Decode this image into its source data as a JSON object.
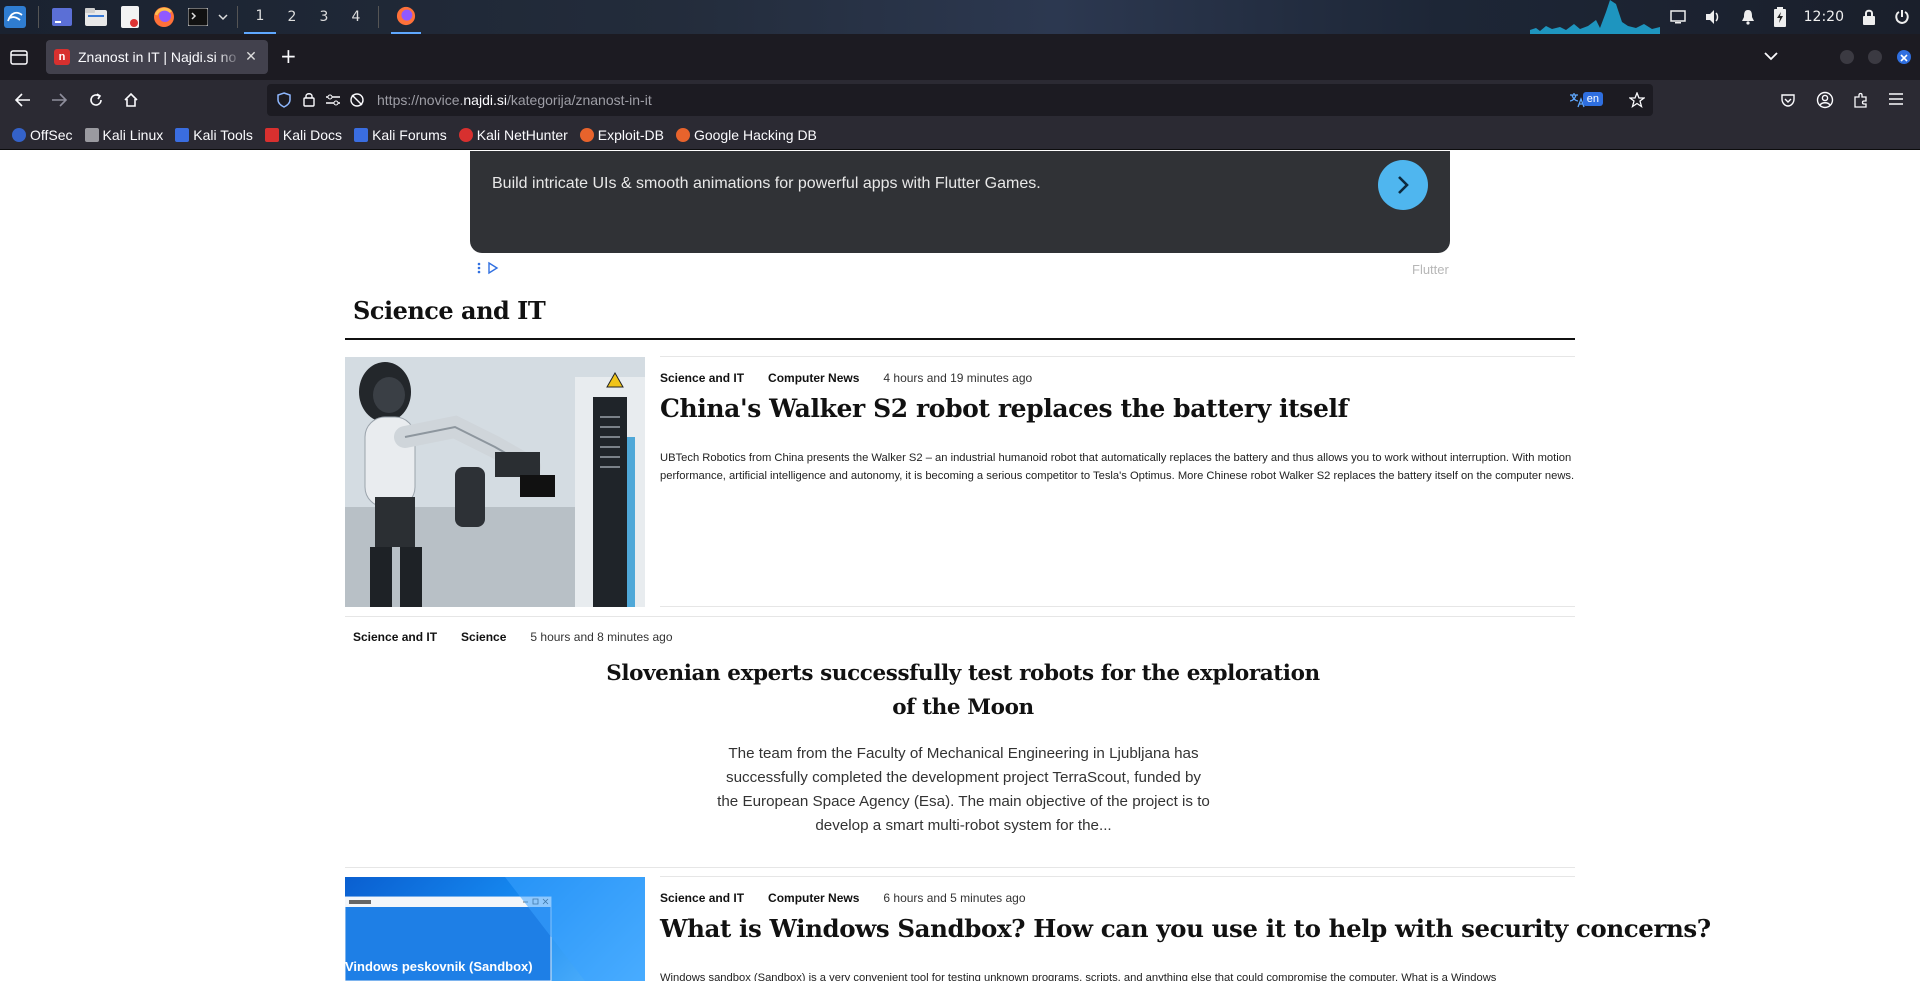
{
  "os_panel": {
    "workspaces": [
      "1",
      "2",
      "3",
      "4"
    ],
    "clock": "12:20",
    "icons": [
      "kali-menu-icon",
      "terminal-desktop-icon",
      "file-manager-icon",
      "text-editor-icon",
      "firefox-icon",
      "terminal-icon",
      "chevron-down-icon"
    ],
    "tray_icons": [
      "screen-icon",
      "volume-icon",
      "notification-bell-icon",
      "battery-icon",
      "lock-icon",
      "power-icon"
    ]
  },
  "browser": {
    "tab_title": "Znanost in IT | Najdi.si no",
    "tab_favicon_letter": "n",
    "url_prefix": "https://novice.",
    "url_host": "najdi.si",
    "url_path": "/kategorija/znanost-in-it",
    "translate_lang": "en",
    "bookmarks": [
      "OffSec",
      "Kali Linux",
      "Kali Tools",
      "Kali Docs",
      "Kali Forums",
      "Kali NetHunter",
      "Exploit-DB",
      "Google Hacking DB"
    ]
  },
  "ad": {
    "text": "Build intricate UIs & smooth animations for powerful apps with Flutter Games.",
    "brand": "Flutter"
  },
  "section": {
    "title": "Science and IT"
  },
  "articles": [
    {
      "category": "Science and IT",
      "subcategory": "Computer News",
      "time": "4 hours and 19 minutes ago",
      "headline": "China's Walker S2 robot replaces the battery itself",
      "summary": "UBTech Robotics from China presents the Walker S2 – an industrial humanoid robot that automatically replaces the battery and thus allows you to work without interruption. With motion performance, artificial intelligence and autonomy, it is becoming a serious competitor to Tesla's Optimus. More Chinese robot Walker S2 replaces the battery itself on the computer news."
    },
    {
      "category": "Science and IT",
      "subcategory": "Science",
      "time": "5 hours and 8 minutes ago",
      "headline": "Slovenian experts successfully test robots for the exploration of the Moon",
      "summary": "The team from the Faculty of Mechanical Engineering in Ljubljana has successfully completed the development project TerraScout, funded by the European Space Agency (Esa). The main objective of the project is to develop a smart multi-robot system for the..."
    },
    {
      "category": "Science and IT",
      "subcategory": "Computer News",
      "time": "6 hours and 5 minutes ago",
      "headline": "What is Windows Sandbox? How can you use it to help with security concerns?",
      "summary": "Windows sandbox (Sandbox) is a very convenient tool for testing unknown programs, scripts, and anything else that could compromise the computer. What is a Windows",
      "image_caption": "Vindows peskovnik (Sandbox)"
    }
  ]
}
